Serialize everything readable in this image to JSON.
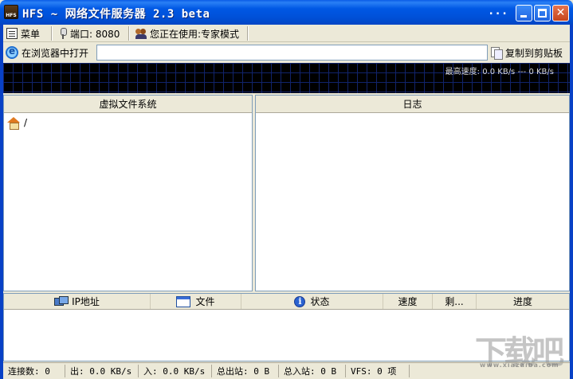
{
  "window": {
    "title": "HFS ~ 网络文件服务器 2.3 beta",
    "title_extra": "...",
    "close_glyph": "✕"
  },
  "toolbar": {
    "menu_label": "菜单",
    "port_label": "端口: 8080",
    "mode_label": "您正在使用:专家模式"
  },
  "browser_bar": {
    "open_in_browser_label": "在浏览器中打开",
    "url_value": "",
    "copy_clipboard_label": "复制到剪贴板"
  },
  "graph": {
    "speed_label": "最高速度: 0.0 KB/s --- 0 KB/s"
  },
  "vfs_panel": {
    "header": "虚拟文件系统",
    "root_label": "/"
  },
  "log_panel": {
    "header": "日志"
  },
  "connections": {
    "columns": [
      "IP地址",
      "文件",
      "状态",
      "速度",
      "剩...",
      "进度"
    ]
  },
  "statusbar": {
    "connections": "连接数: 0",
    "out_speed": "出: 0.0 KB/s",
    "in_speed": "入: 0.0 KB/s",
    "total_out": "总出站: 0 B",
    "total_in": "总入站: 0 B",
    "vfs_items": "VFS: 0 项"
  },
  "watermark": {
    "logo_text": "下载吧",
    "logo_url": "www.xiazaiba.com"
  },
  "colors": {
    "titlebar": "#0058e4",
    "graph_bg": "#000000",
    "graph_grid": "#11236b",
    "panel_border": "#7f9db9",
    "chrome": "#ece9d8"
  }
}
